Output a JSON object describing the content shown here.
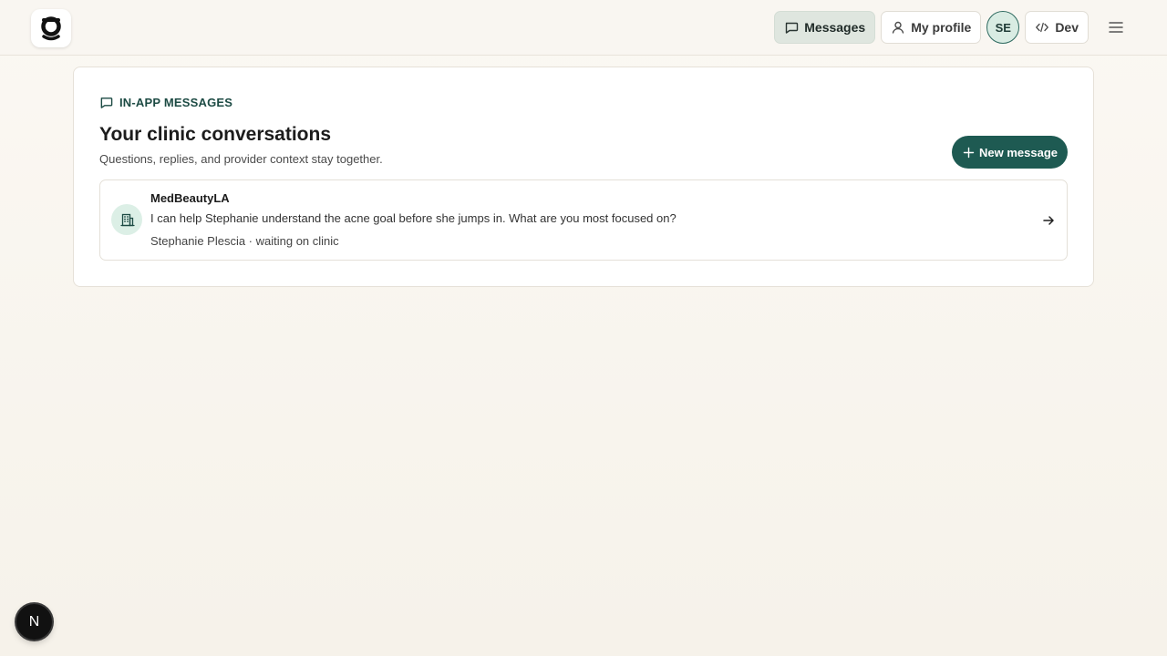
{
  "header": {
    "logo_icon": "brand-logo-icon",
    "nav": {
      "messages_label": "Messages",
      "profile_label": "My profile",
      "avatar_initials": "SE",
      "dev_label": "Dev"
    }
  },
  "main": {
    "eyebrow": "IN-APP MESSAGES",
    "title": "Your clinic conversations",
    "subtitle": "Questions, replies, and provider context stay together.",
    "new_message_label": "New message",
    "conversations": [
      {
        "name": "MedBeautyLA",
        "preview": "I can help Stephanie understand the acne goal before she jumps in. What are you most focused on?",
        "meta": "Stephanie Plescia · waiting on clinic"
      }
    ]
  },
  "floating_button": {
    "label": "N"
  },
  "colors": {
    "accent": "#1e5a52",
    "page_background": "#f7f3ec",
    "card_background": "#ffffff"
  }
}
